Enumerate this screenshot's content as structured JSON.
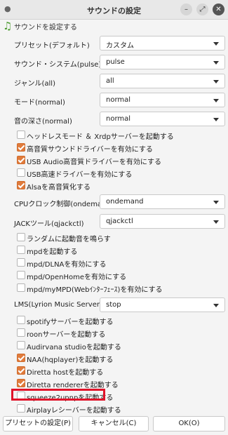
{
  "window": {
    "title": "サウンドの設定"
  },
  "header": {
    "text": "サウンドを設定する"
  },
  "settings": [
    {
      "label": "プリセット(デフォルト)",
      "value": "カスタム"
    },
    {
      "label": "サウンド・システム(pulse)",
      "value": "pulse"
    },
    {
      "label": "ジャンル(all)",
      "value": "all"
    },
    {
      "label": "モード(normal)",
      "value": "normal"
    },
    {
      "label": "音の深さ(normal)",
      "value": "normal"
    }
  ],
  "checks1": [
    {
      "label": "ヘッドレスモード ＆ Xrdpサーバーを起動する",
      "checked": false
    },
    {
      "label": "高音質サウンドドライバーを有効にする",
      "checked": true
    },
    {
      "label": "USB Audio高音質ドライバーを有効にする",
      "checked": true
    },
    {
      "label": "USB高速ドライバーを有効にする",
      "checked": false
    },
    {
      "label": "Alsaを高音質化する",
      "checked": true
    }
  ],
  "cpu": {
    "label": "CPUクロック制御(ondemand)",
    "value": "ondemand"
  },
  "jack": {
    "label": "JACKツール(qjackctl)",
    "value": "qjackctl"
  },
  "checks2": [
    {
      "label": "ランダムに起動音を鳴らす",
      "checked": false
    },
    {
      "label": "mpdを起動する",
      "checked": false
    },
    {
      "label": "mpd/DLNAを有効にする",
      "checked": false
    },
    {
      "label": "mpd/OpenHomeを有効にする",
      "checked": false
    },
    {
      "label": "mpd/myMPD(Webｲﾝﾀｰﾌｪｰｽ)を有効にする",
      "checked": false
    }
  ],
  "lms": {
    "label": "LMS(Lyrion Music Server)",
    "value": "stop"
  },
  "checks3": [
    {
      "label": "spotifyサーバーを起動する",
      "checked": false
    },
    {
      "label": "roonサーバーを起動する",
      "checked": false
    },
    {
      "label": "Audirvana studioを起動する",
      "checked": false
    },
    {
      "label": "NAA(hqplayer)を起動する",
      "checked": true
    },
    {
      "label": "Diretta hostを起動する",
      "checked": true
    },
    {
      "label": "Diretta rendererを起動する",
      "checked": true
    },
    {
      "label": "squeeze2upnpを起動する",
      "checked": false
    },
    {
      "label": "Airplayレシーバーを起動する",
      "checked": false
    }
  ],
  "buttons": {
    "preset": "プリセットの設定(P)",
    "cancel": "キャンセル(C)",
    "ok": "OK(O)"
  },
  "colors": {
    "accent": "#e07b3c",
    "highlight": "#e0142a"
  }
}
